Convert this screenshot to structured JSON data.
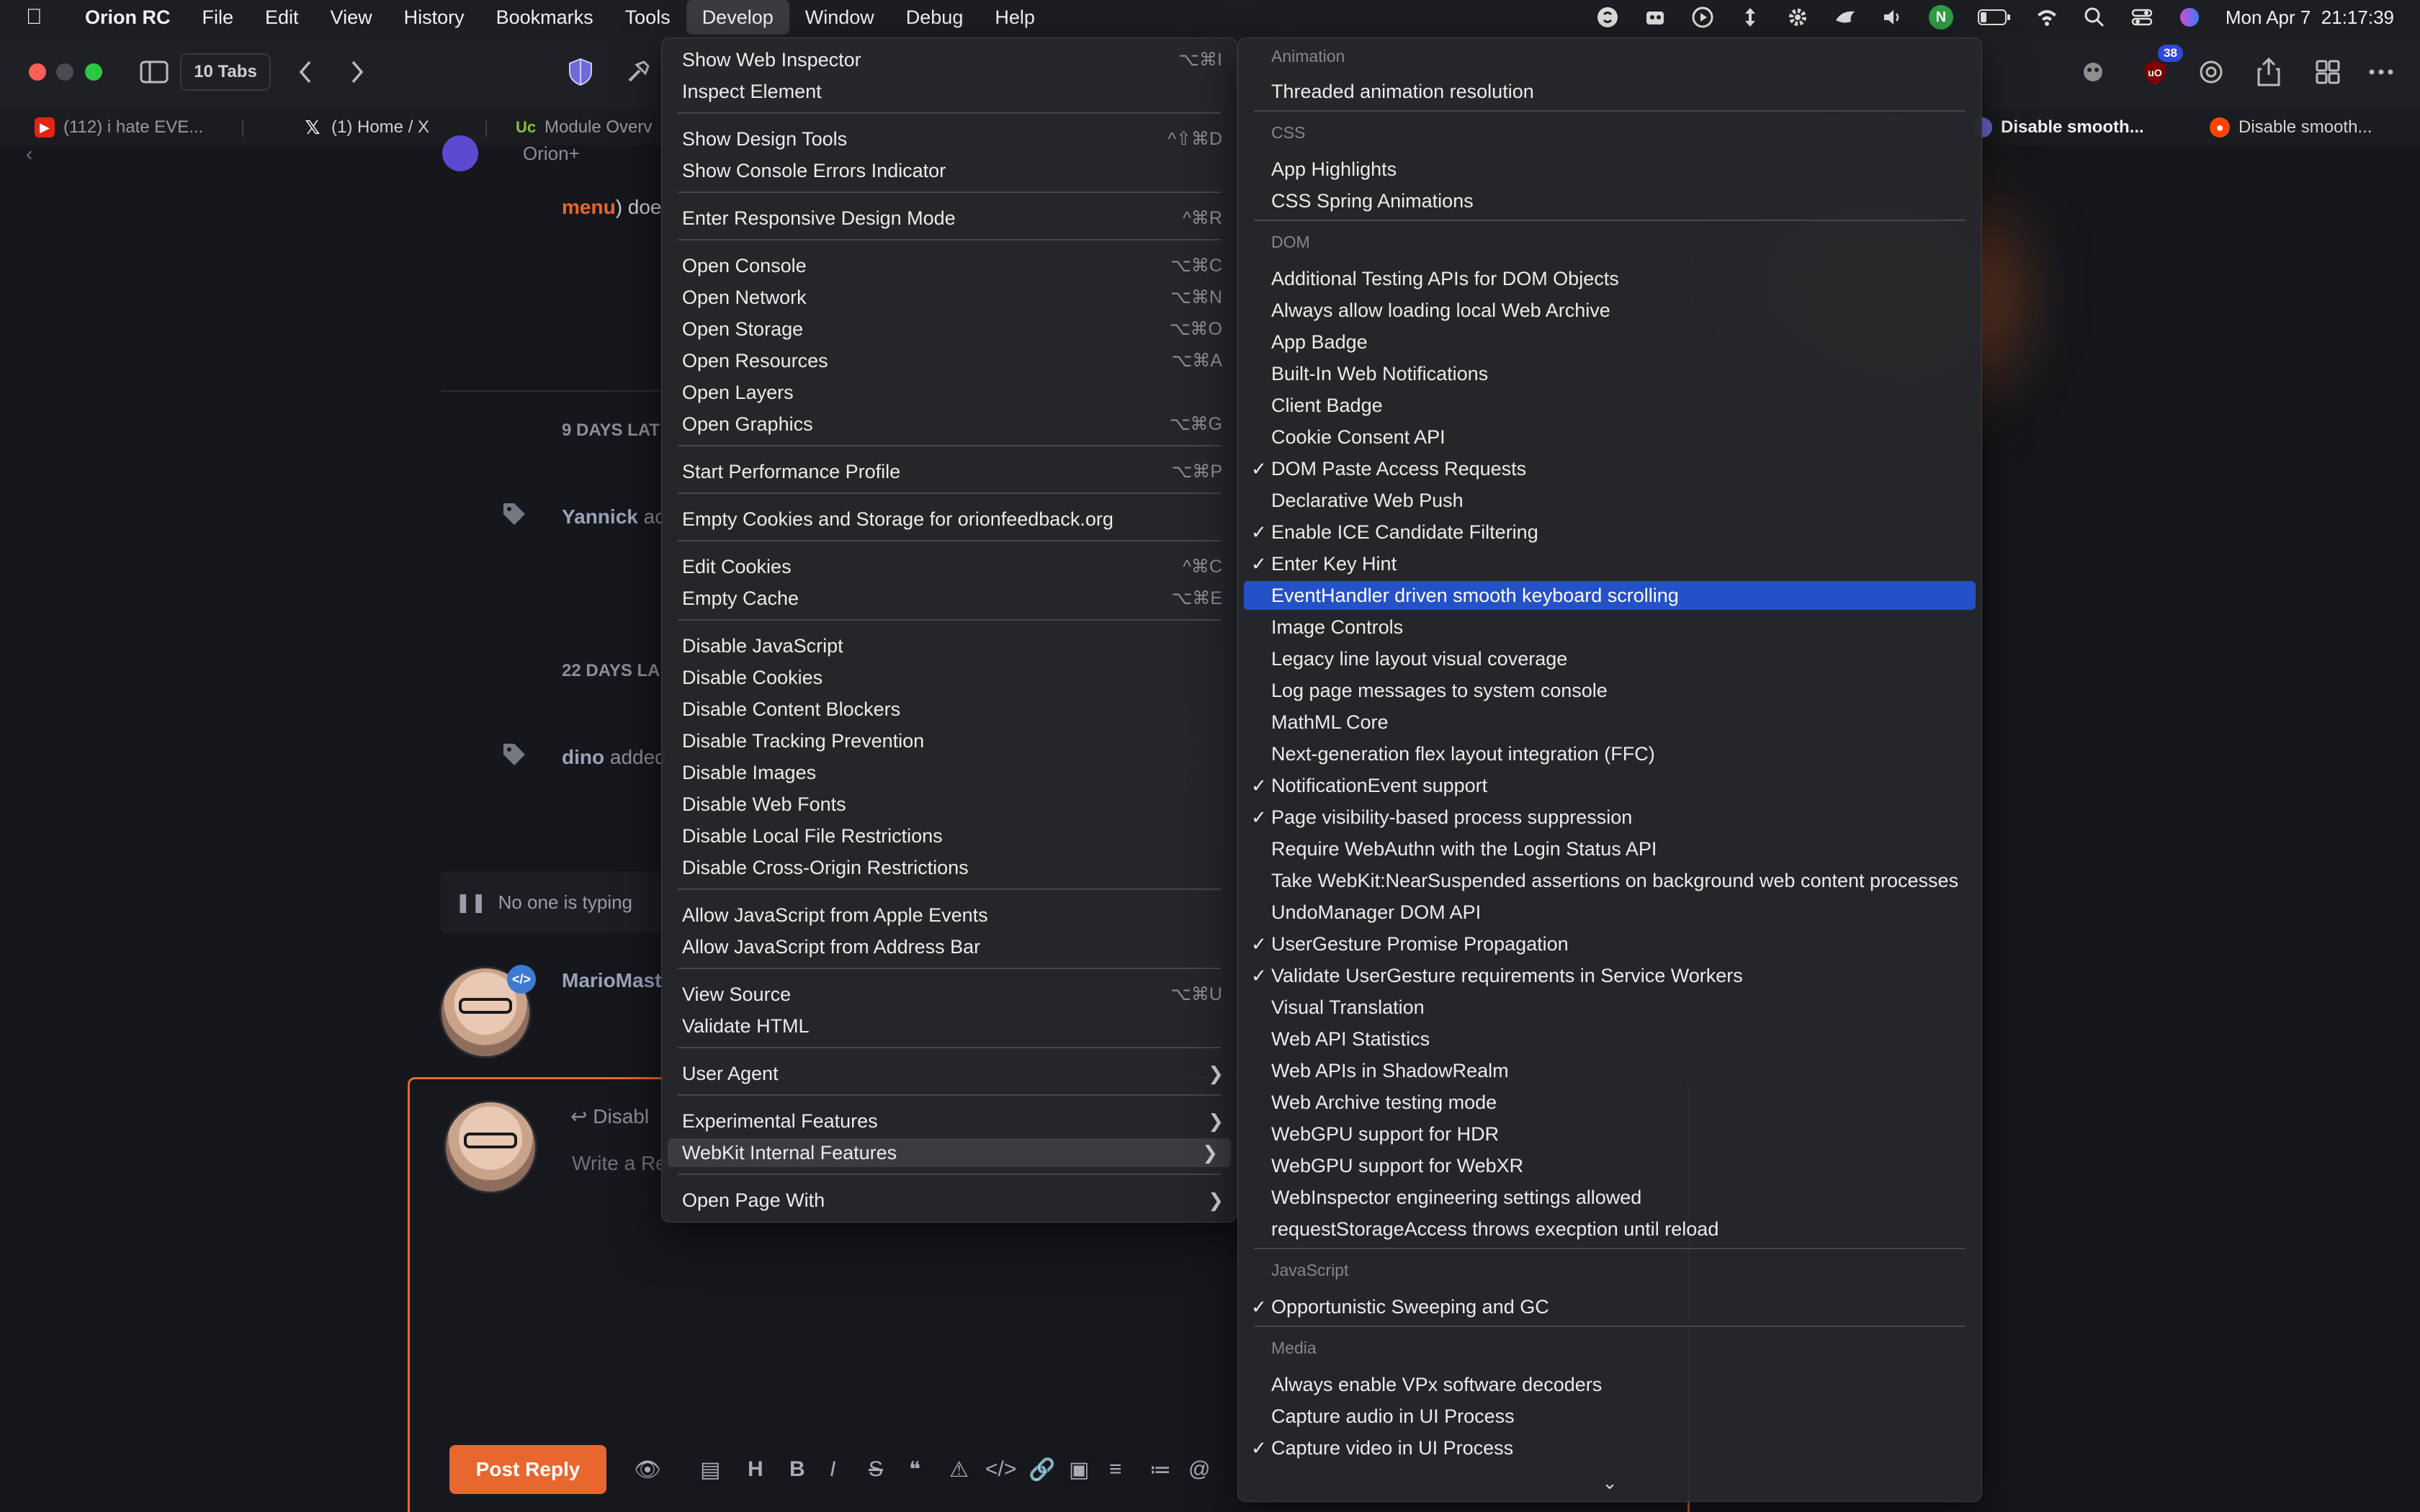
{
  "menubar": {
    "app": "Orion RC",
    "items": [
      "File",
      "Edit",
      "View",
      "History",
      "Bookmarks",
      "Tools",
      "Develop",
      "Window",
      "Debug",
      "Help"
    ],
    "active": "Develop",
    "clock": "Mon Apr 7  21:17:39",
    "status_icons": [
      "shazam-icon",
      "extension-icon",
      "play-icon",
      "arrows-icon",
      "gear-icon",
      "bird-icon",
      "volume-icon",
      "n-badge-icon",
      "battery-icon",
      "wifi-icon",
      "search-icon",
      "control-center-icon",
      "siri-icon"
    ],
    "n_badge": "N"
  },
  "toolbar": {
    "tabs_count": "10 Tabs",
    "ublock_count": "38"
  },
  "tabs": [
    {
      "label": "(112) i hate EVE...",
      "favicon": "youtube"
    },
    {
      "label": "(1) Home / X",
      "favicon": "x"
    },
    {
      "label": "Module Overv",
      "favicon": "uc"
    },
    {
      "label": "Disable smooth...",
      "favicon": "orion"
    },
    {
      "label": "Disable smooth...",
      "favicon": "reddit"
    }
  ],
  "page": {
    "orion_label": "Orion+",
    "menu_word": "menu",
    "menu_rest": ") doe",
    "days_1": "9 DAYS LAT",
    "user_1": "Yannick",
    "user_1_rest": " ac",
    "days_2": "22 DAYS LA",
    "user_2": "dino",
    "user_2_rest": " added",
    "typing": "No one is typing",
    "user_3": "MarioMast",
    "reply_label": "Disabl",
    "reply_placeholder": "Write a Re",
    "post_reply": "Post Reply"
  },
  "develop_menu": {
    "items": [
      {
        "label": "Show Web Inspector",
        "shortcut": "⌥⌘I"
      },
      {
        "label": "Inspect Element",
        "shortcut": ""
      },
      {
        "label": "Show Design Tools",
        "shortcut": "^⇧⌘D"
      },
      {
        "label": "Show Console Errors Indicator",
        "shortcut": ""
      },
      {
        "label": "Enter Responsive Design Mode",
        "shortcut": "^⌘R"
      },
      {
        "label": "Open Console",
        "shortcut": "⌥⌘C"
      },
      {
        "label": "Open Network",
        "shortcut": "⌥⌘N"
      },
      {
        "label": "Open Storage",
        "shortcut": "⌥⌘O"
      },
      {
        "label": "Open Resources",
        "shortcut": "⌥⌘A"
      },
      {
        "label": "Open Layers",
        "shortcut": ""
      },
      {
        "label": "Open Graphics",
        "shortcut": "⌥⌘G"
      },
      {
        "label": "Start Performance Profile",
        "shortcut": "⌥⌘P"
      },
      {
        "label": "Empty Cookies and Storage for orionfeedback.org",
        "shortcut": ""
      },
      {
        "label": "Edit Cookies",
        "shortcut": "^⌘C"
      },
      {
        "label": "Empty Cache",
        "shortcut": "⌥⌘E"
      },
      {
        "label": "Disable JavaScript",
        "shortcut": ""
      },
      {
        "label": "Disable Cookies",
        "shortcut": ""
      },
      {
        "label": "Disable Content Blockers",
        "shortcut": ""
      },
      {
        "label": "Disable Tracking Prevention",
        "shortcut": ""
      },
      {
        "label": "Disable Images",
        "shortcut": ""
      },
      {
        "label": "Disable Web Fonts",
        "shortcut": ""
      },
      {
        "label": "Disable Local File Restrictions",
        "shortcut": ""
      },
      {
        "label": "Disable Cross-Origin Restrictions",
        "shortcut": ""
      },
      {
        "label": "Allow JavaScript from Apple Events",
        "shortcut": ""
      },
      {
        "label": "Allow JavaScript from Address Bar",
        "shortcut": ""
      },
      {
        "label": "View Source",
        "shortcut": "⌥⌘U"
      },
      {
        "label": "Validate HTML",
        "shortcut": ""
      },
      {
        "label": "User Agent",
        "shortcut": ""
      },
      {
        "label": "Experimental Features",
        "shortcut": ""
      },
      {
        "label": "WebKit Internal Features",
        "shortcut": ""
      },
      {
        "label": "Open Page With",
        "shortcut": ""
      }
    ]
  },
  "webkit_menu": {
    "sections": {
      "animation": "Animation",
      "css": "CSS",
      "dom": "DOM",
      "javascript": "JavaScript",
      "media": "Media"
    },
    "items": [
      {
        "label": "Threaded animation resolution",
        "checked": false
      },
      {
        "label": "App Highlights",
        "checked": false
      },
      {
        "label": "CSS Spring Animations",
        "checked": false
      },
      {
        "label": "Additional Testing APIs for DOM Objects",
        "checked": false
      },
      {
        "label": "Always allow loading local Web Archive",
        "checked": false
      },
      {
        "label": "App Badge",
        "checked": false
      },
      {
        "label": "Built-In Web Notifications",
        "checked": false
      },
      {
        "label": "Client Badge",
        "checked": false
      },
      {
        "label": "Cookie Consent API",
        "checked": false
      },
      {
        "label": "DOM Paste Access Requests",
        "checked": true
      },
      {
        "label": "Declarative Web Push",
        "checked": false
      },
      {
        "label": "Enable ICE Candidate Filtering",
        "checked": true
      },
      {
        "label": "Enter Key Hint",
        "checked": true
      },
      {
        "label": "EventHandler driven smooth keyboard scrolling",
        "checked": false
      },
      {
        "label": "Image Controls",
        "checked": false
      },
      {
        "label": "Legacy line layout visual coverage",
        "checked": false
      },
      {
        "label": "Log page messages to system console",
        "checked": false
      },
      {
        "label": "MathML Core",
        "checked": false
      },
      {
        "label": "Next-generation flex layout integration (FFC)",
        "checked": false
      },
      {
        "label": "NotificationEvent support",
        "checked": true
      },
      {
        "label": "Page visibility-based process suppression",
        "checked": true
      },
      {
        "label": "Require WebAuthn with the Login Status API",
        "checked": false
      },
      {
        "label": "Take WebKit:NearSuspended assertions on background web content processes",
        "checked": false
      },
      {
        "label": "UndoManager DOM API",
        "checked": false
      },
      {
        "label": "UserGesture Promise Propagation",
        "checked": true
      },
      {
        "label": "Validate UserGesture requirements in Service Workers",
        "checked": true
      },
      {
        "label": "Visual Translation",
        "checked": false
      },
      {
        "label": "Web API Statistics",
        "checked": false
      },
      {
        "label": "Web APIs in ShadowRealm",
        "checked": false
      },
      {
        "label": "Web Archive testing mode",
        "checked": false
      },
      {
        "label": "WebGPU support for HDR",
        "checked": false
      },
      {
        "label": "WebGPU support for WebXR",
        "checked": false
      },
      {
        "label": "WebInspector engineering settings allowed",
        "checked": false
      },
      {
        "label": "requestStorageAccess throws execption until reload",
        "checked": false
      },
      {
        "label": "Opportunistic Sweeping and GC",
        "checked": true
      },
      {
        "label": "Always enable VPx software decoders",
        "checked": false
      },
      {
        "label": "Capture audio in UI Process",
        "checked": false
      },
      {
        "label": "Capture video in UI Process",
        "checked": true
      }
    ],
    "highlighted": "EventHandler driven smooth keyboard scrolling",
    "check_glyph": "✓"
  },
  "colors": {
    "accent_orange": "#e8672e",
    "highlight_blue": "#2450c8"
  }
}
